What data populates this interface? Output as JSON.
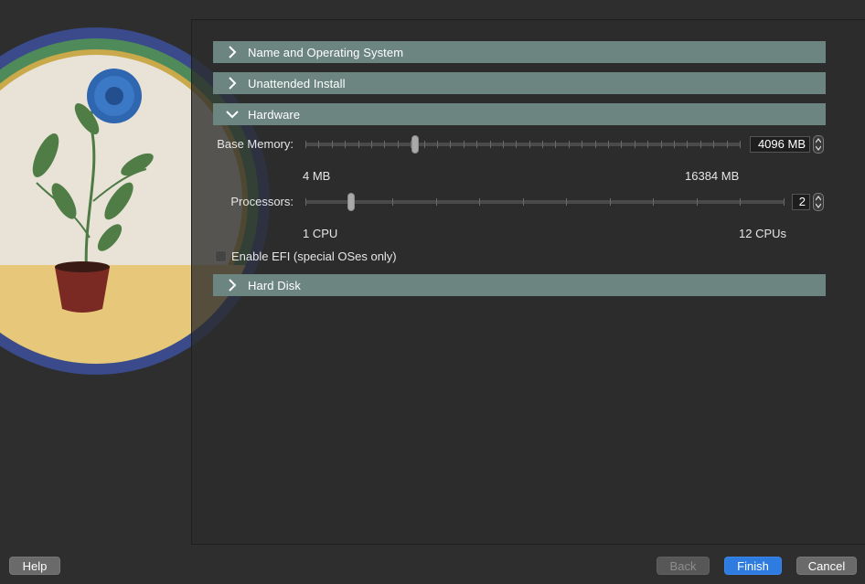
{
  "sections": {
    "name_os": {
      "label": "Name and Operating System",
      "expanded": false
    },
    "unattended": {
      "label": "Unattended Install",
      "expanded": false
    },
    "hardware": {
      "label": "Hardware",
      "expanded": true
    },
    "hard_disk": {
      "label": "Hard Disk",
      "expanded": false
    }
  },
  "hardware": {
    "base_memory": {
      "label": "Base Memory:",
      "value": "4096 MB",
      "min_label": "4 MB",
      "max_label": "16384 MB",
      "min": 4,
      "max": 16384,
      "current": 4096
    },
    "processors": {
      "label": "Processors:",
      "value": "2",
      "min_label": "1 CPU",
      "max_label": "12 CPUs",
      "min": 1,
      "max": 12,
      "current": 2
    },
    "efi": {
      "label": "Enable EFI (special OSes only)",
      "checked": false
    }
  },
  "buttons": {
    "help": "Help",
    "back": "Back",
    "finish": "Finish",
    "cancel": "Cancel"
  },
  "colors": {
    "header_bg": "#6c8580",
    "primary": "#2f7ce0",
    "window_bg": "#2e2e2e"
  },
  "icons": {
    "collapsed": "chevron-right-icon",
    "expanded": "chevron-down-icon",
    "illustration": "potted-plant-illustration"
  }
}
